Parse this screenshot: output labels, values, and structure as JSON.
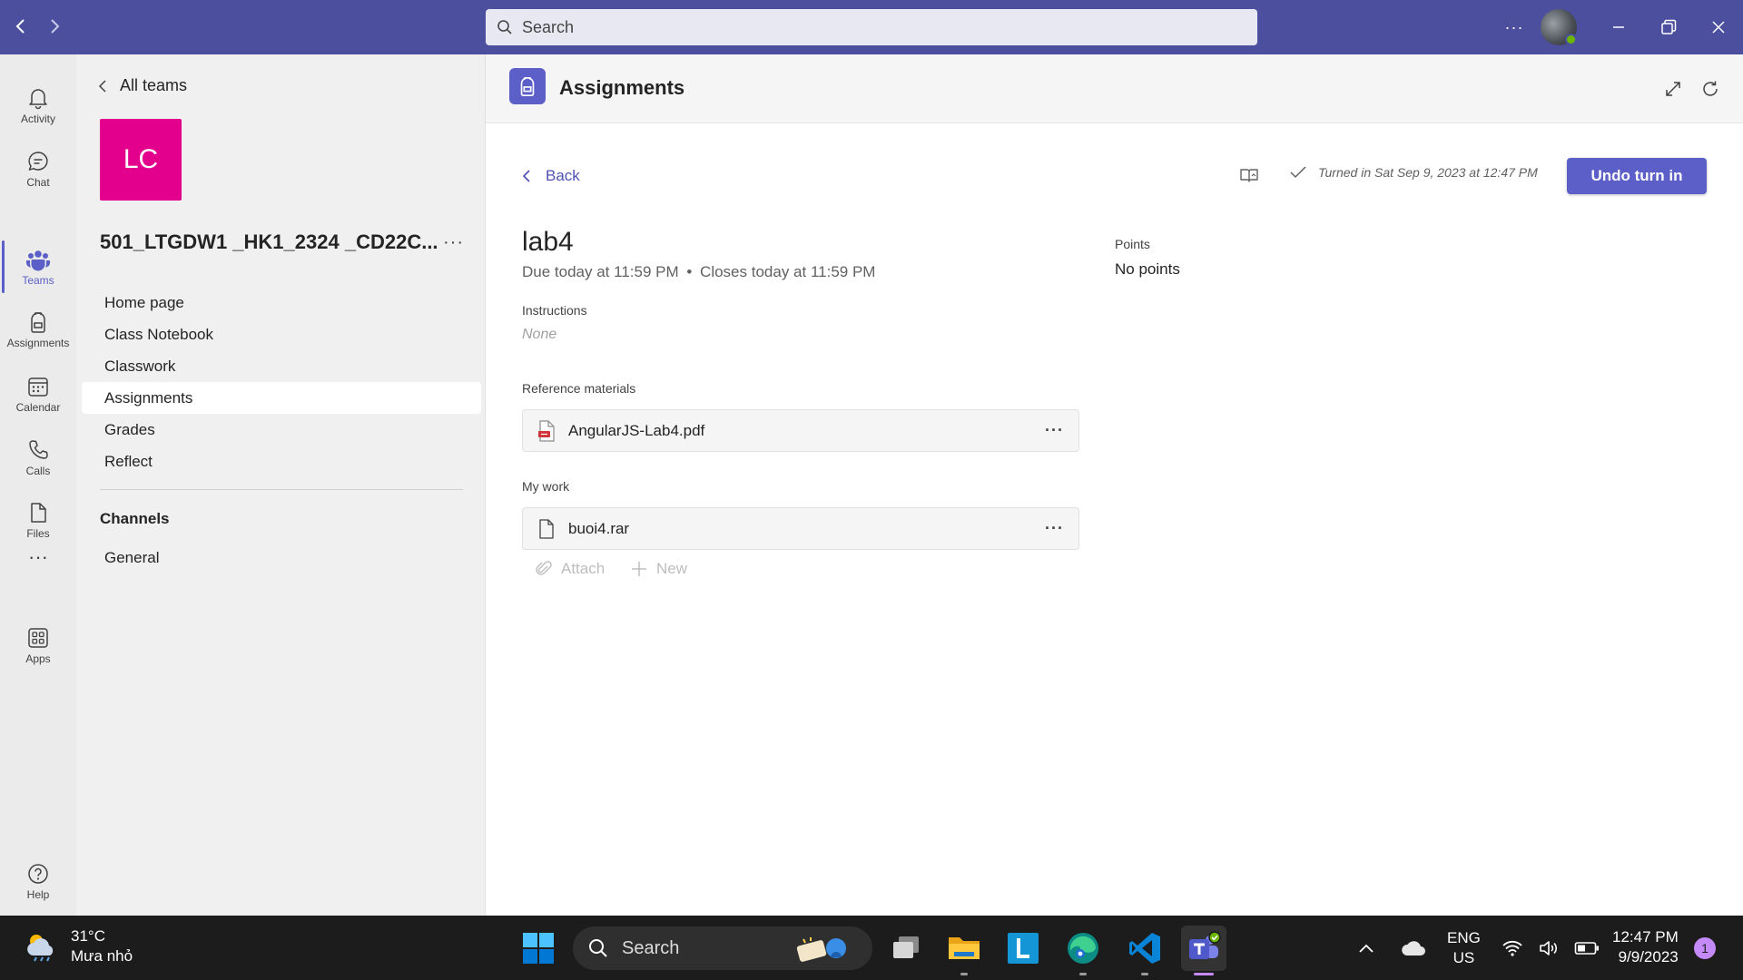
{
  "titlebar": {
    "search_placeholder": "Search",
    "more": "···"
  },
  "rail": {
    "items": [
      {
        "label": "Activity",
        "icon": "bell-icon"
      },
      {
        "label": "Chat",
        "icon": "chat-icon"
      },
      {
        "label": "Teams",
        "icon": "teams-icon",
        "active": true
      },
      {
        "label": "Assignments",
        "icon": "backpack-icon"
      },
      {
        "label": "Calendar",
        "icon": "calendar-icon"
      },
      {
        "label": "Calls",
        "icon": "phone-icon"
      },
      {
        "label": "Files",
        "icon": "file-icon"
      }
    ],
    "more": "···",
    "apps": "Apps",
    "help": "Help"
  },
  "team": {
    "all_teams": "All teams",
    "logo_initials": "LC",
    "logo_color": "#e3008c",
    "name": "501_LTGDW1 _HK1_2324 _CD22C...",
    "more": "···",
    "nav": [
      "Home page",
      "Class Notebook",
      "Classwork",
      "Assignments",
      "Grades",
      "Reflect"
    ],
    "active_nav": "Assignments",
    "channels_heading": "Channels",
    "channels": [
      "General"
    ]
  },
  "main": {
    "app_title": "Assignments",
    "back": "Back",
    "turned_in": "Turned in Sat Sep 9, 2023 at 12:47 PM",
    "undo_button": "Undo turn in",
    "accent": "#5b5fc7",
    "assignment": {
      "title": "lab4",
      "due": "Due today at 11:59 PM",
      "separator": "•",
      "closes": "Closes today at 11:59 PM",
      "points_label": "Points",
      "points_value": "No points",
      "instructions_label": "Instructions",
      "instructions_value": "None",
      "reference_label": "Reference materials",
      "reference_files": [
        {
          "name": "AngularJS-Lab4.pdf",
          "icon": "pdf-icon"
        }
      ],
      "mywork_label": "My work",
      "mywork_files": [
        {
          "name": "buoi4.rar",
          "icon": "document-icon"
        }
      ],
      "attach": "Attach",
      "new": "New",
      "file_more": "···"
    }
  },
  "taskbar": {
    "weather_temp": "31°C",
    "weather_desc": "Mưa nhỏ",
    "search": "Search",
    "lang_1": "ENG",
    "lang_2": "US",
    "time": "12:47 PM",
    "date": "9/9/2023",
    "notifications": "1"
  }
}
